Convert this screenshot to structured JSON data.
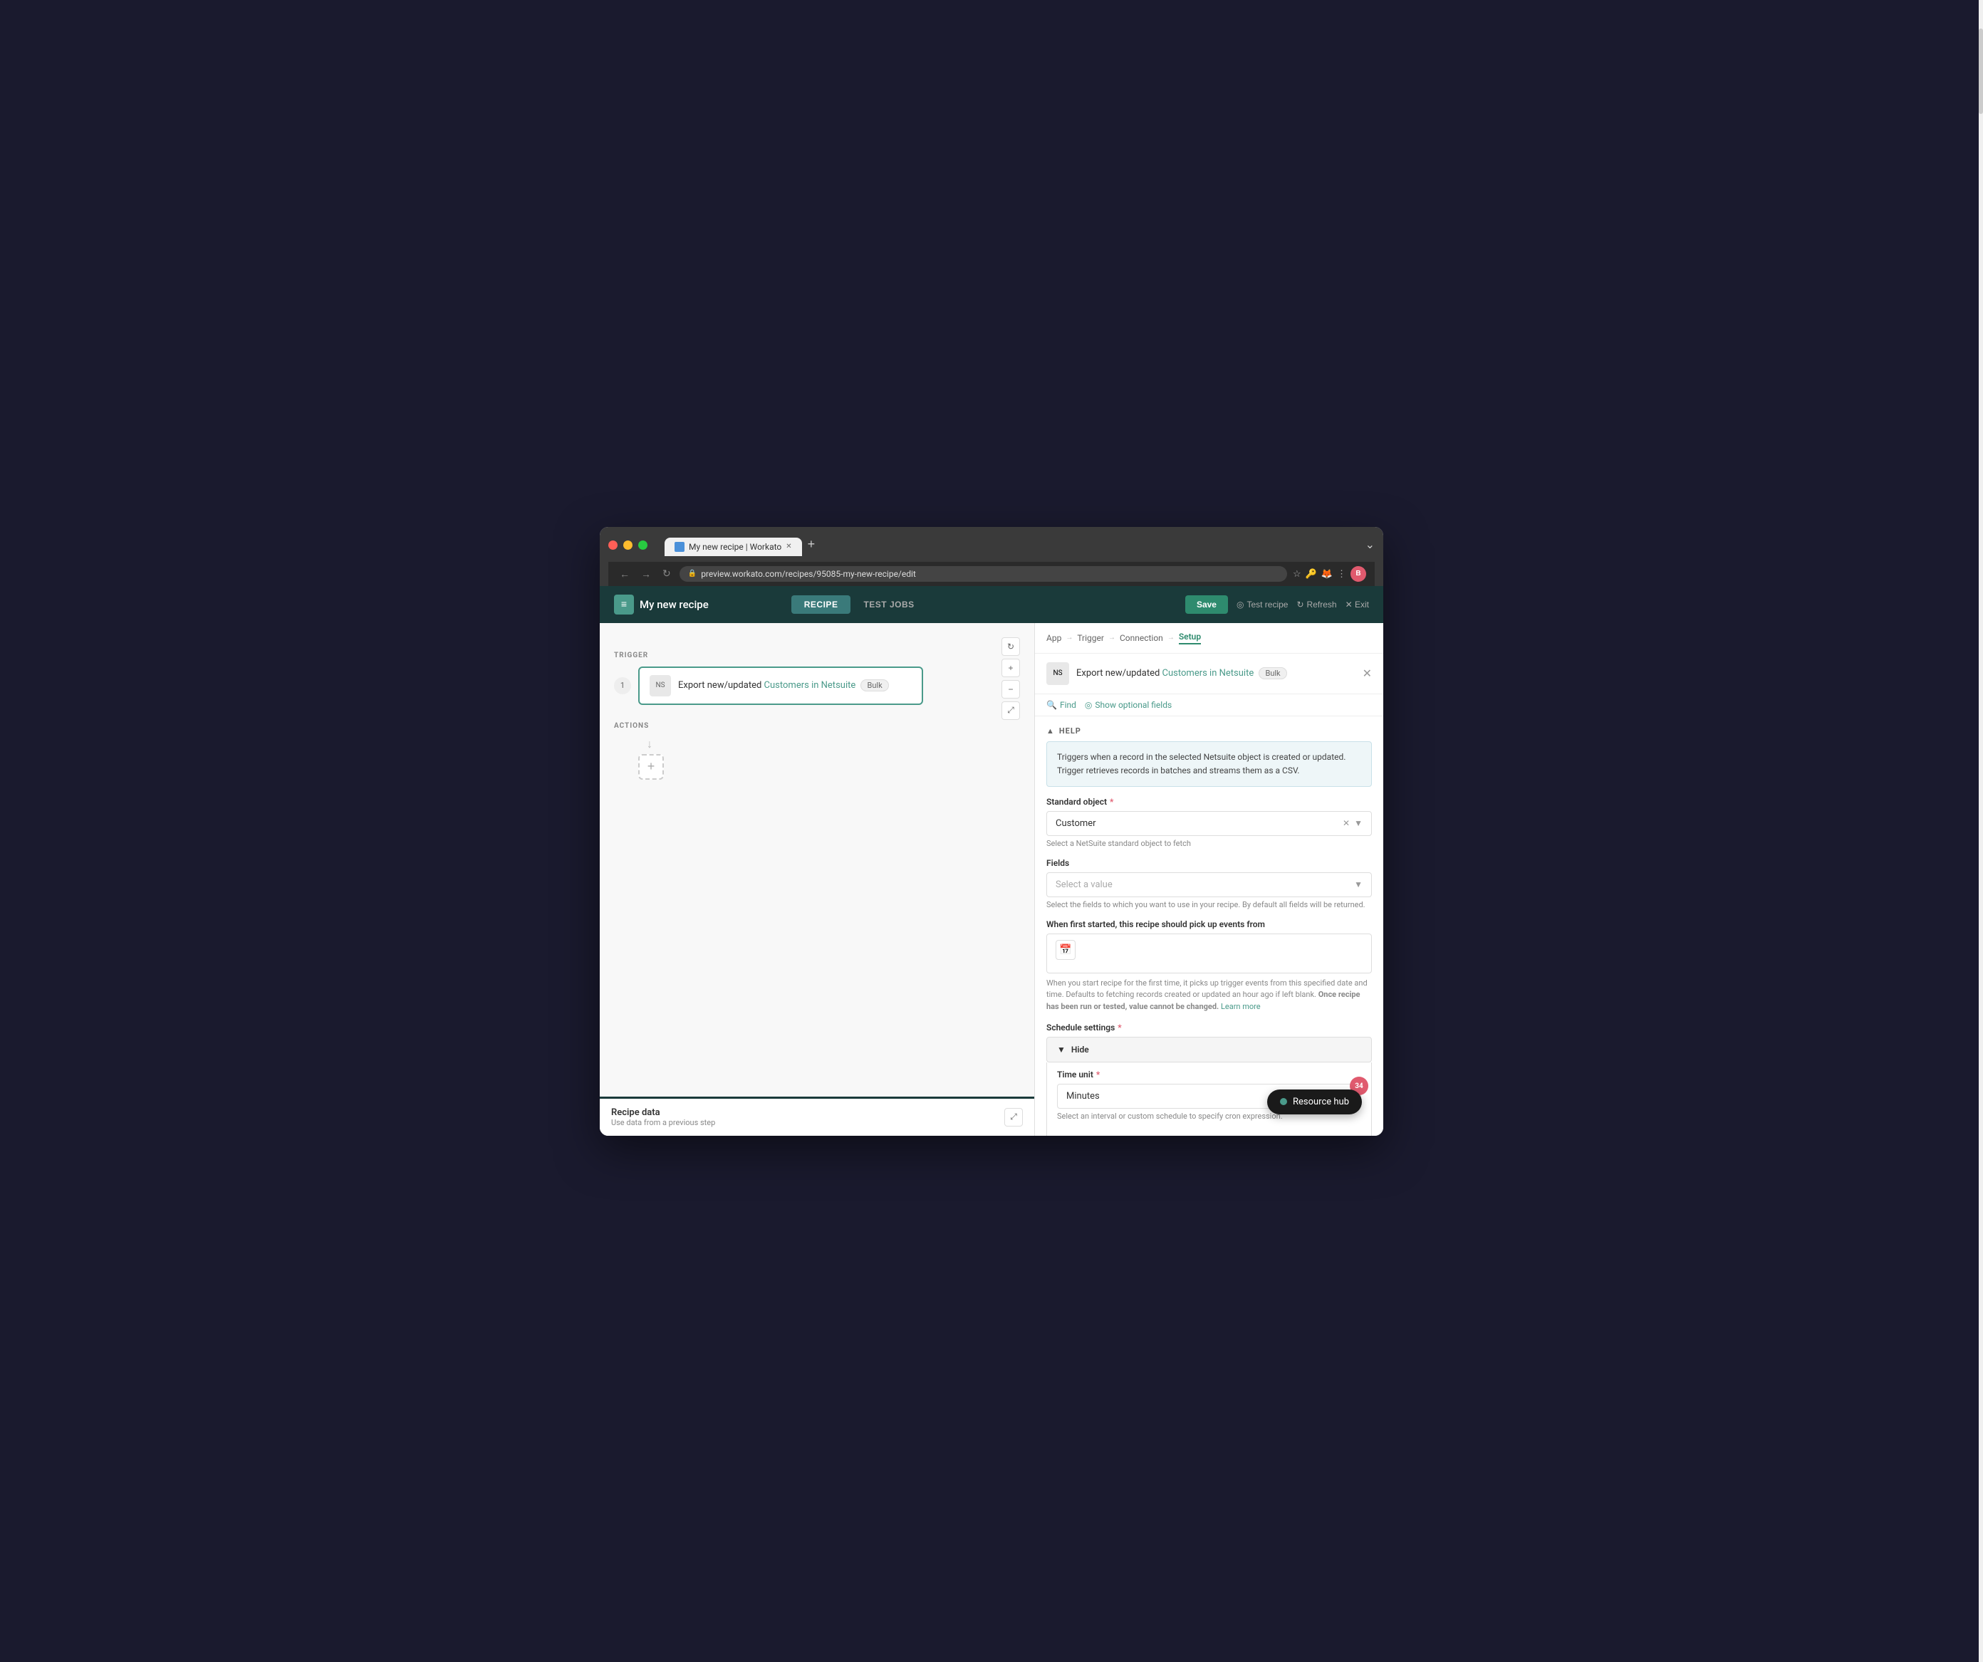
{
  "browser": {
    "tab_title": "My new recipe | Workato",
    "url": "preview.workato.com/recipes/95085-my-new-recipe/edit",
    "new_tab_icon": "+",
    "chevron": "⌄"
  },
  "header": {
    "logo_icon": "≡",
    "recipe_title": "My new recipe",
    "tabs": [
      {
        "id": "recipe",
        "label": "RECIPE",
        "active": true
      },
      {
        "id": "test-jobs",
        "label": "TEST JOBS",
        "active": false
      }
    ],
    "save_label": "Save",
    "test_recipe_label": "Test recipe",
    "refresh_label": "Refresh",
    "exit_label": "Exit"
  },
  "canvas": {
    "trigger_label": "TRIGGER",
    "actions_label": "ACTIONS",
    "step_number": "1",
    "step_description": "Export new/updated",
    "step_highlight": "Customers",
    "step_connector": "in Netsuite",
    "step_badge": "Bulk",
    "add_step_icon": "+",
    "controls": {
      "refresh": "↻",
      "plus": "+",
      "minus": "−",
      "expand": "⤢"
    }
  },
  "recipe_data_panel": {
    "title": "Recipe data",
    "subtitle": "Use data from a previous step",
    "expand_icon": "⤢"
  },
  "right_panel": {
    "breadcrumb": [
      "App",
      "Trigger",
      "Connection",
      "Setup"
    ],
    "active_breadcrumb": "Setup",
    "header_title": "Export new/updated",
    "header_highlight": "Customers in Netsuite",
    "header_badge": "Bulk",
    "find_label": "Find",
    "optional_fields_label": "Show optional fields",
    "help_section": {
      "label": "HELP",
      "content": "Triggers when a record in the selected Netsuite object is created or updated. Trigger retrieves records in batches and streams them as a CSV."
    },
    "standard_object": {
      "label": "Standard object",
      "required": true,
      "value": "Customer",
      "hint": "Select a NetSuite standard object to fetch"
    },
    "fields": {
      "label": "Fields",
      "placeholder": "Select a value",
      "hint": "Select the fields to which you want to use in your recipe. By default all fields will be returned."
    },
    "when_started": {
      "label": "When first started, this recipe should pick up events from",
      "hint_part1": "When you start recipe for the first time, it picks up trigger events from this specified date and time. Defaults to fetching records created or updated an hour ago if left blank.",
      "hint_bold": "Once recipe has been run or tested, value cannot be changed.",
      "hint_link": "Learn more"
    },
    "schedule_settings": {
      "label": "Schedule settings",
      "required": true,
      "toggle_label": "Hide"
    },
    "time_unit": {
      "label": "Time unit",
      "required": true,
      "value": "Minutes",
      "hint": "Select an interval or custom schedule to specify cron expression.",
      "badge": "34"
    }
  },
  "resource_hub": {
    "label": "Resource hub",
    "dot_icon": "●"
  }
}
